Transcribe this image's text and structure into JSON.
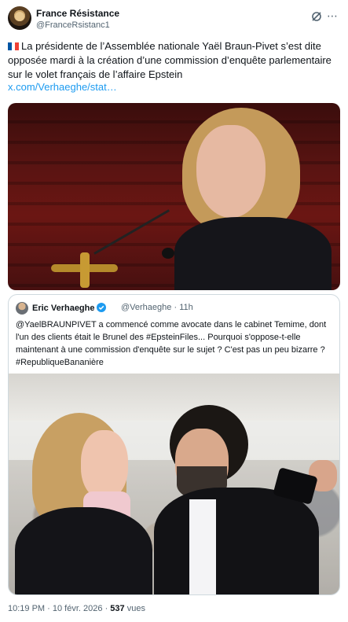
{
  "author": {
    "name": "France Résistance",
    "handle": "@FranceRsistanc1"
  },
  "tweet": {
    "flag": "french-flag-icon",
    "text": "La présidente de l’Assemblée nationale Yaël Braun-Pivet s’est dite opposée mardi à la création d’une commission d’enquête parlementaire sur le volet français de l’affaire Epstein",
    "link": "x.com/Verhaeghe/stat…"
  },
  "quoted": {
    "name": "Eric Verhaeghe",
    "handle": "@Verhaeghe",
    "separator": "·",
    "time": "11h",
    "text": "@YaelBRAUNPIVET a commencé comme avocate dans le cabinet Temime, dont l'un des clients était le Brunel des #EpsteinFiles... Pourquoi s'oppose-t-elle maintenant à une commission d'enquête  sur le sujet ? C'est pas un peu bizarre ? #RepubliqueBananière"
  },
  "footer": {
    "time": "10:19 PM",
    "separator": "·",
    "date": "10 févr. 2026",
    "separator2": "·",
    "views_count": "537",
    "views_label": "vues"
  },
  "colors": {
    "link": "#1d9bf0",
    "muted": "#536471",
    "verified": "#1d9bf0"
  }
}
